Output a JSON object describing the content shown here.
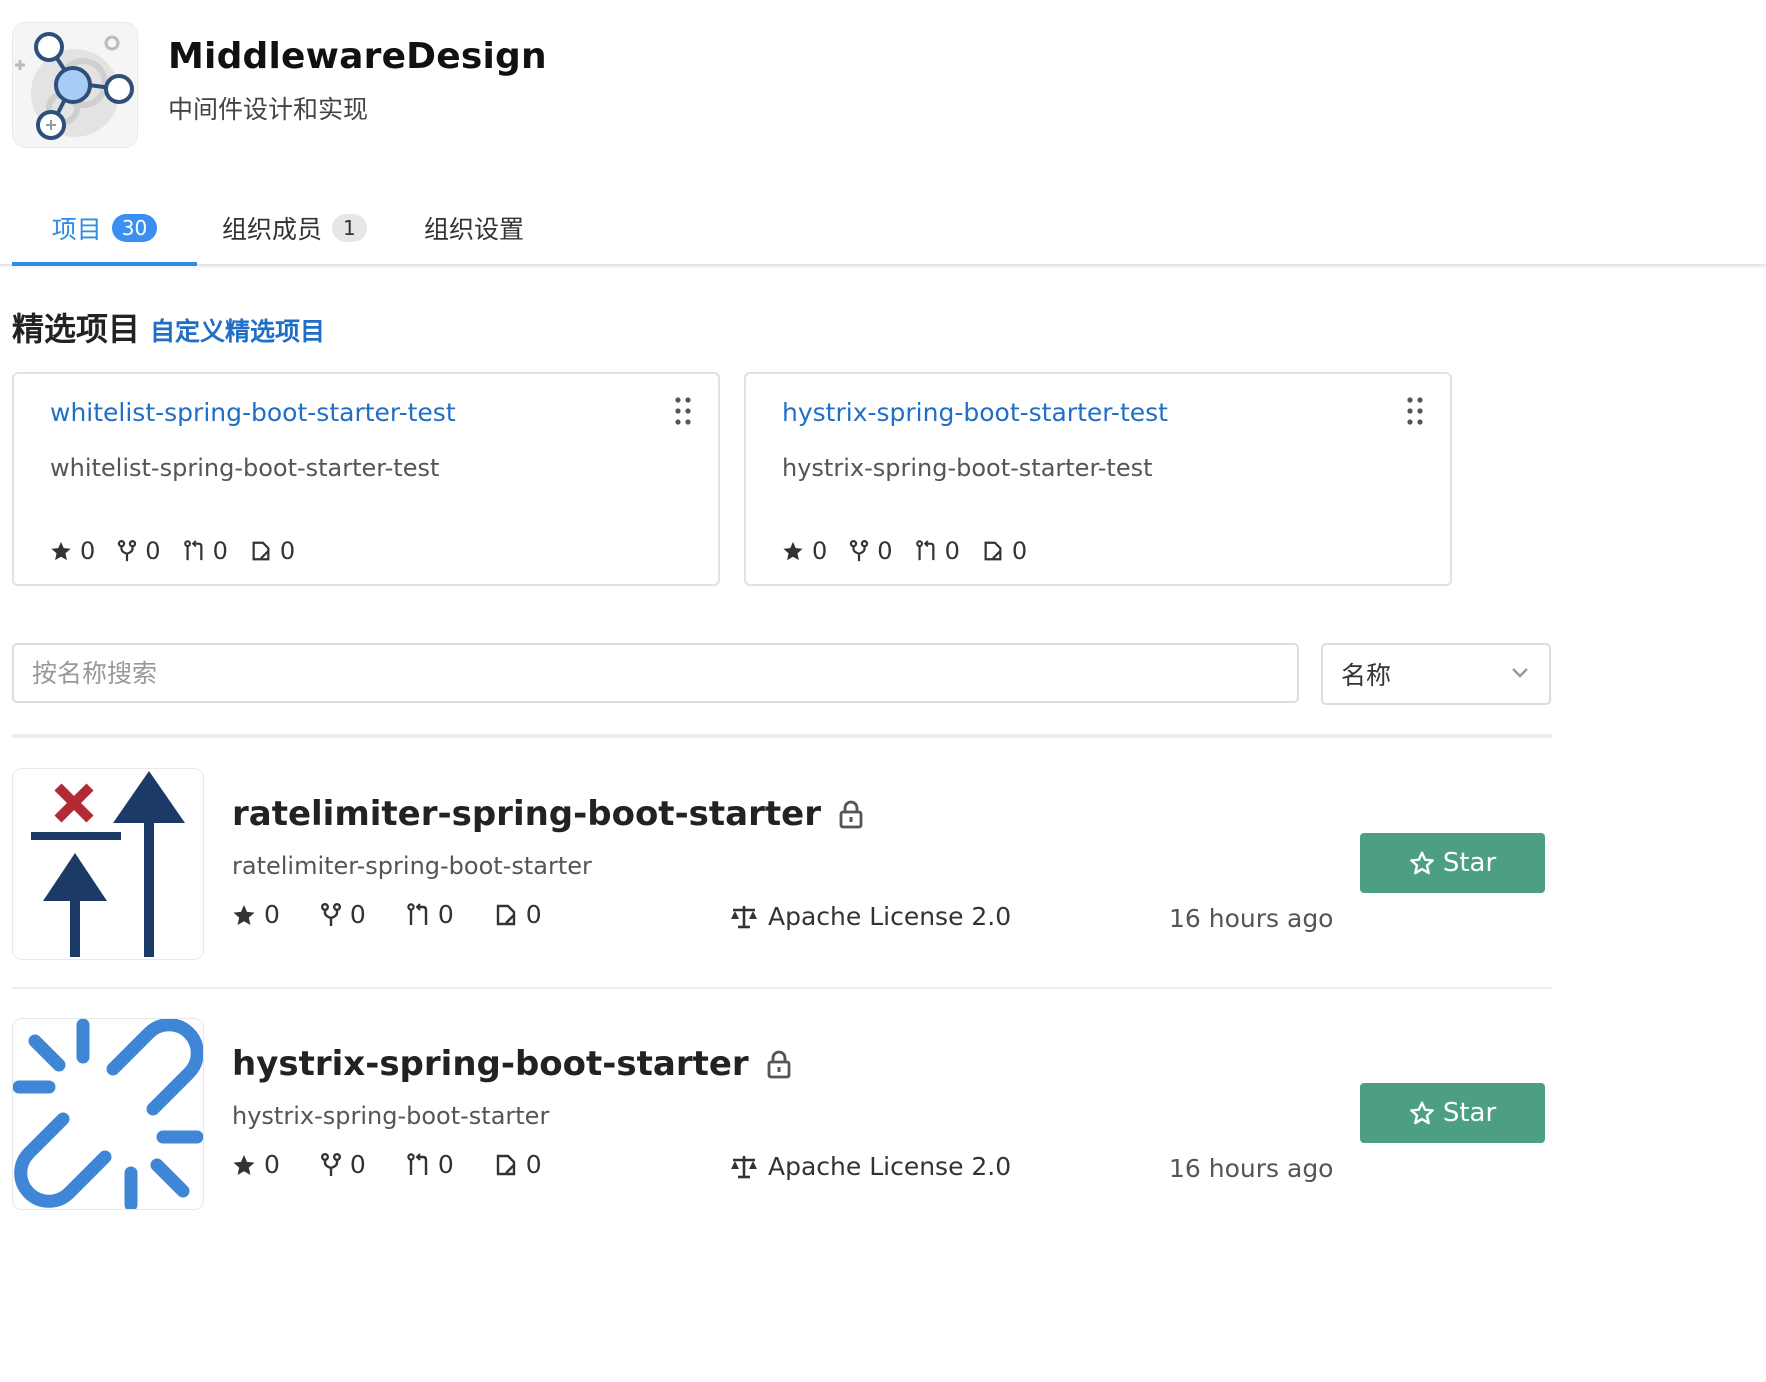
{
  "org": {
    "name": "MiddlewareDesign",
    "description": "中间件设计和实现"
  },
  "tabs": [
    {
      "label": "项目",
      "count": "30",
      "active": true
    },
    {
      "label": "组织成员",
      "count": "1",
      "active": false
    },
    {
      "label": "组织设置",
      "active": false
    }
  ],
  "featured": {
    "title": "精选项目",
    "customize_link": "自定义精选项目",
    "cards": [
      {
        "title": "whitelist-spring-boot-starter-test",
        "description": "whitelist-spring-boot-starter-test",
        "stars": "0",
        "forks": "0",
        "pull_requests": "0",
        "issues": "0"
      },
      {
        "title": "hystrix-spring-boot-starter-test",
        "description": "hystrix-spring-boot-starter-test",
        "stars": "0",
        "forks": "0",
        "pull_requests": "0",
        "issues": "0"
      }
    ]
  },
  "search": {
    "placeholder": "按名称搜索",
    "sort_value": "名称"
  },
  "projects": [
    {
      "title": "ratelimiter-spring-boot-starter",
      "description": "ratelimiter-spring-boot-starter",
      "stars": "0",
      "forks": "0",
      "pull_requests": "0",
      "issues": "0",
      "license": "Apache License 2.0",
      "updated": "16 hours ago",
      "star_label": "Star",
      "avatar_icon": "rate-limit-arrows-icon"
    },
    {
      "title": "hystrix-spring-boot-starter",
      "description": "hystrix-spring-boot-starter",
      "stars": "0",
      "forks": "0",
      "pull_requests": "0",
      "issues": "0",
      "license": "Apache License 2.0",
      "updated": "16 hours ago",
      "star_label": "Star",
      "avatar_icon": "broken-link-icon"
    }
  ],
  "colors": {
    "accent": "#2d8ce6",
    "link": "#1f6fc7",
    "star_button": "#4c9f85"
  }
}
